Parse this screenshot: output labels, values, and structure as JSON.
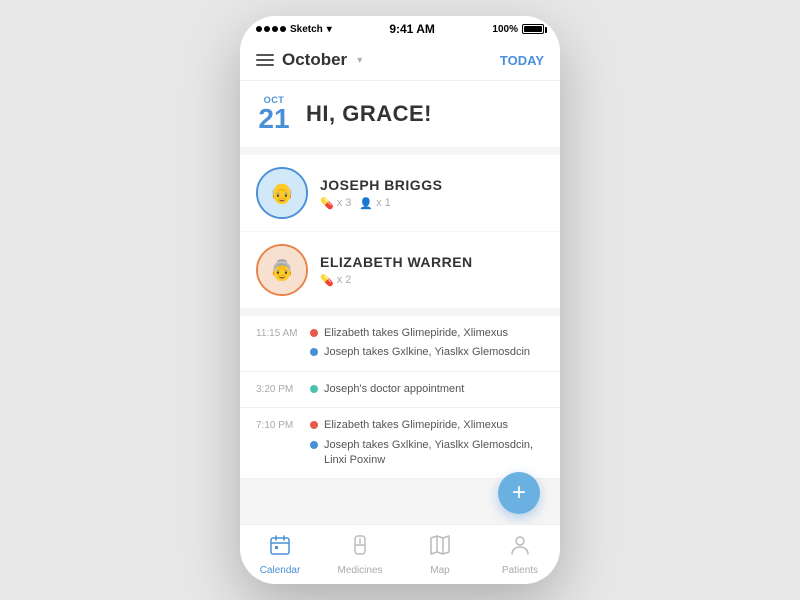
{
  "statusBar": {
    "signal": "••••",
    "carrier": "Sketch",
    "wifi": "⌘",
    "time": "9:41 AM",
    "battery": "100%"
  },
  "header": {
    "title": "October",
    "todayLabel": "TODAY"
  },
  "greeting": {
    "month": "OCT",
    "day": "21",
    "text": "HI, GRACE!"
  },
  "patients": [
    {
      "name": "JOSEPH BRIGGS",
      "avatar_emoji": "👴",
      "avatar_color": "blue",
      "pill_count": "x 3",
      "person_count": "x 1"
    },
    {
      "name": "ELIZABETH WARREN",
      "avatar_emoji": "👵",
      "avatar_color": "orange",
      "pill_count": "x 2",
      "person_count": null
    }
  ],
  "schedule": [
    {
      "time": "11:15 AM",
      "events": [
        {
          "type": "red",
          "text": "Elizabeth takes Glimepiride, Xlimexus"
        },
        {
          "type": "blue",
          "text": "Joseph takes Gxlkine, Yiaslkx Glemosdcin"
        }
      ]
    },
    {
      "time": "3:20 PM",
      "events": [
        {
          "type": "teal",
          "text": "Joseph's doctor appointment",
          "single": true
        }
      ]
    },
    {
      "time": "7:10 PM",
      "events": [
        {
          "type": "red",
          "text": "Elizabeth takes Glimepiride, Xlimexus"
        },
        {
          "type": "blue",
          "text": "Joseph takes Gxlkine, Yiaslkx Glemosdcin, Linxi Poxinw"
        }
      ]
    }
  ],
  "fab": {
    "label": "+"
  },
  "bottomNav": [
    {
      "id": "calendar",
      "icon": "📅",
      "label": "Calendar",
      "active": true
    },
    {
      "id": "medicines",
      "icon": "💊",
      "label": "Medicines",
      "active": false
    },
    {
      "id": "map",
      "icon": "🗺",
      "label": "Map",
      "active": false
    },
    {
      "id": "patients",
      "icon": "👤",
      "label": "Patients",
      "active": false
    }
  ]
}
